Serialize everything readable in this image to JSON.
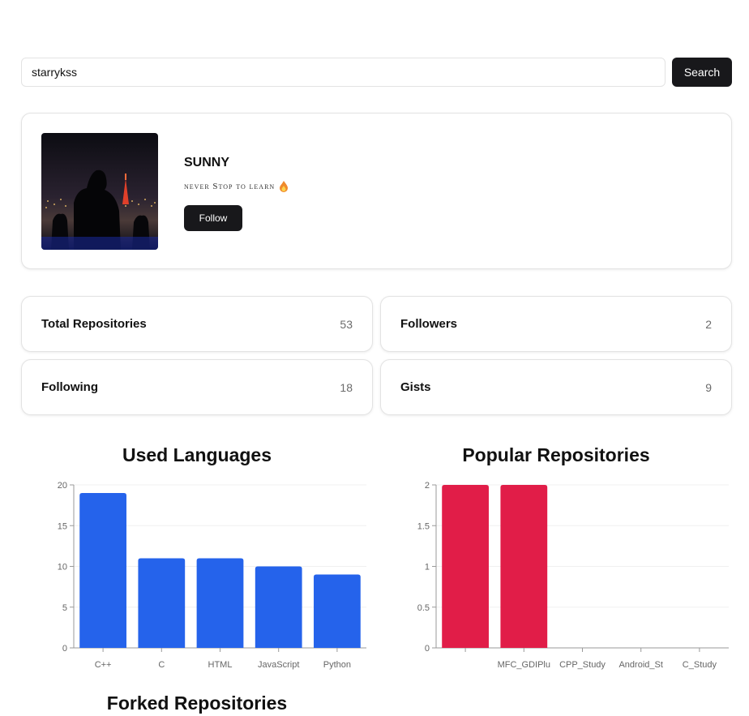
{
  "search": {
    "value": "starrykss",
    "button_label": "Search"
  },
  "profile": {
    "name": "SUNNY",
    "bio": "never Stop to learn",
    "follow_label": "Follow"
  },
  "stats": [
    {
      "label": "Total Repositories",
      "value": "53"
    },
    {
      "label": "Followers",
      "value": "2"
    },
    {
      "label": "Following",
      "value": "18"
    },
    {
      "label": "Gists",
      "value": "9"
    }
  ],
  "colors": {
    "languages_bar": "#2563eb",
    "popular_bar": "#e11d48",
    "button_bg": "#18181b"
  },
  "chart_data": [
    {
      "type": "bar",
      "title": "Used Languages",
      "categories": [
        "C++",
        "C",
        "HTML",
        "JavaScript",
        "Python"
      ],
      "values": [
        19,
        11,
        11,
        10,
        9
      ],
      "ylim": [
        0,
        20
      ],
      "yticks": [
        "0",
        "5",
        "10",
        "15",
        "20"
      ],
      "grid": true
    },
    {
      "type": "bar",
      "title": "Popular Repositories",
      "categories": [
        "",
        "MFC_GDIPlu",
        "CPP_Study",
        "Android_St",
        "C_Study"
      ],
      "values": [
        2,
        2,
        0,
        0,
        0
      ],
      "ylim": [
        0,
        2
      ],
      "yticks": [
        "0",
        "0.5",
        "1",
        "1.5",
        "2"
      ],
      "grid": true
    }
  ],
  "forked_title": "Forked Repositories"
}
